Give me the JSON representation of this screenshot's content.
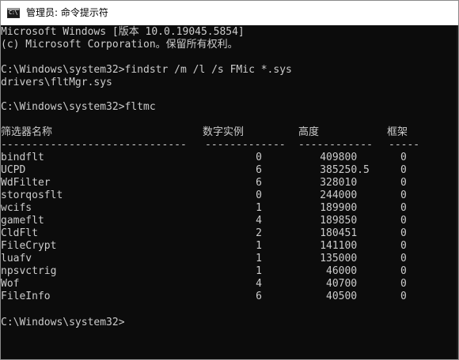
{
  "window": {
    "title": "管理员: 命令提示符",
    "icon": "console-icon",
    "icon_glyph": "C:\\"
  },
  "console": {
    "header_lines": [
      "Microsoft Windows [版本 10.0.19045.5854]",
      "(c) Microsoft Corporation。保留所有权利。"
    ],
    "findstr_command": "C:\\Windows\\system32>findstr /m /l /s FMic *.sys",
    "findstr_result": "drivers\\fltMgr.sys",
    "fltmc_command": "C:\\Windows\\system32>fltmc",
    "table": {
      "headers": [
        "筛选器名称",
        "数字实例",
        "高度",
        "框架"
      ],
      "separators": [
        "------------------------------",
        "-------------",
        "------------",
        "-----"
      ],
      "rows": [
        [
          "bindflt",
          "0",
          "409800",
          "0"
        ],
        [
          "UCPD",
          "6",
          "385250.5",
          "0"
        ],
        [
          "WdFilter",
          "6",
          "328010",
          "0"
        ],
        [
          "storqosflt",
          "0",
          "244000",
          "0"
        ],
        [
          "wcifs",
          "1",
          "189900",
          "0"
        ],
        [
          "gameflt",
          "4",
          "189850",
          "0"
        ],
        [
          "CldFlt",
          "2",
          "180451",
          "0"
        ],
        [
          "FileCrypt",
          "1",
          "141100",
          "0"
        ],
        [
          "luafv",
          "1",
          "135000",
          "0"
        ],
        [
          "npsvctrig",
          "1",
          "46000",
          "0"
        ],
        [
          "Wof",
          "4",
          "40700",
          "0"
        ],
        [
          "FileInfo",
          "6",
          "40500",
          "0"
        ]
      ]
    },
    "prompt": "C:\\Windows\\system32>"
  }
}
